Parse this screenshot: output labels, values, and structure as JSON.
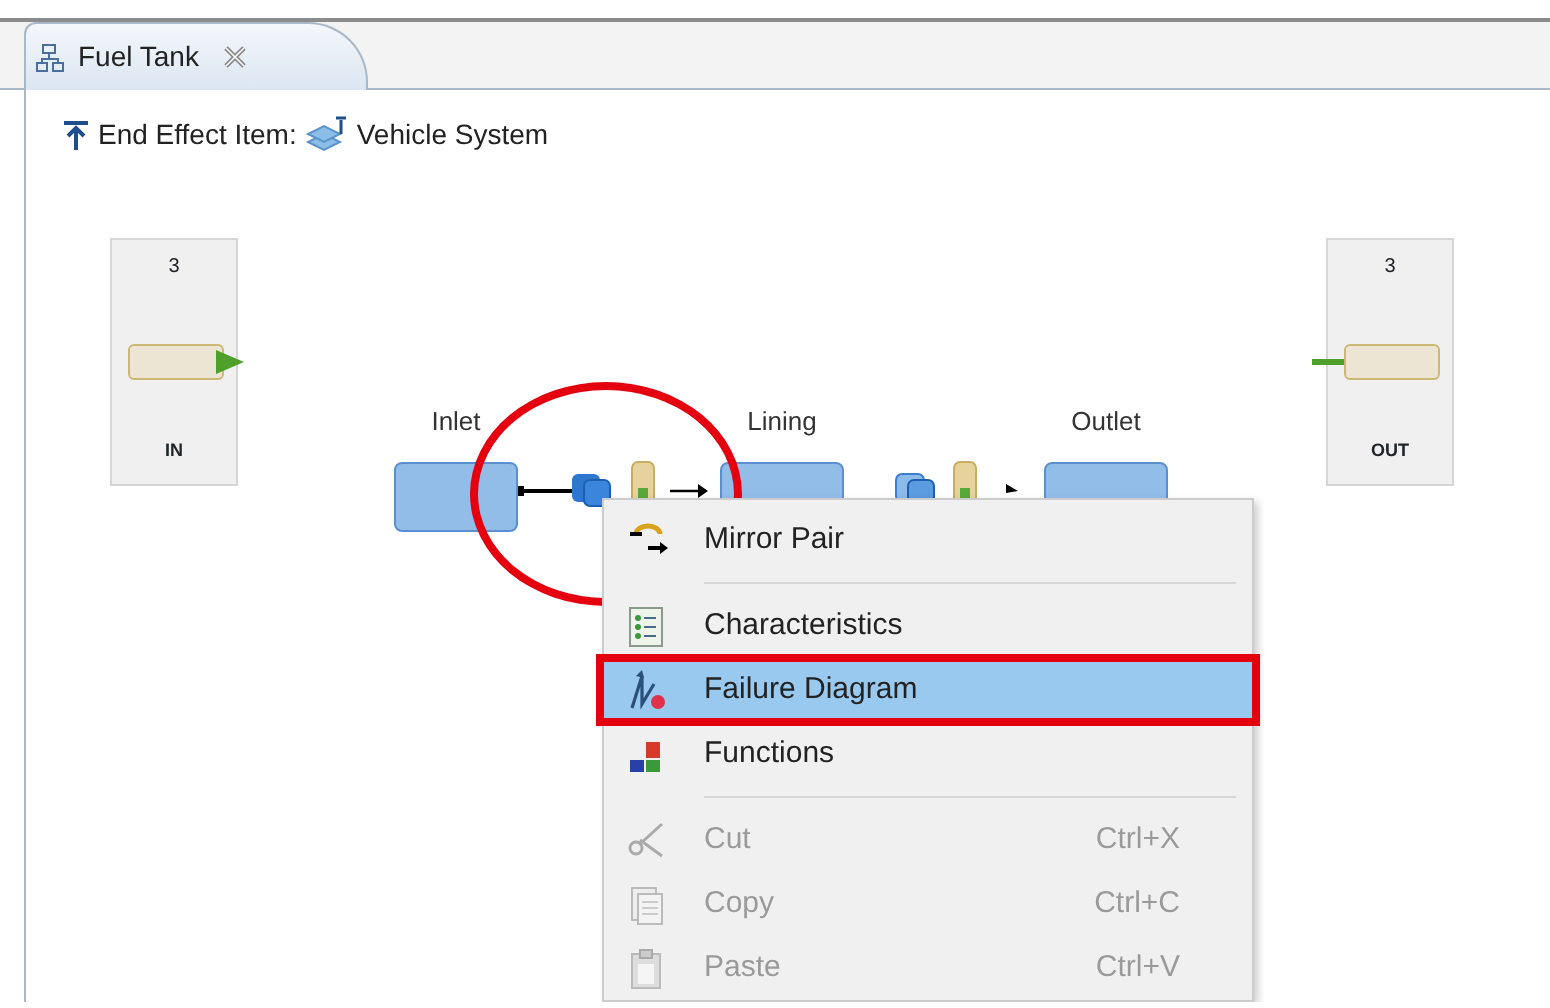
{
  "tab": {
    "title": "Fuel Tank",
    "selected": true
  },
  "end_effect": {
    "label": "End Effect Item:",
    "value": "Vehicle System"
  },
  "ports": [
    {
      "number": "3",
      "label": "IN",
      "kind": "in"
    },
    {
      "number": "3",
      "label": "OUT",
      "kind": "out"
    }
  ],
  "blocks": [
    {
      "name": "Inlet"
    },
    {
      "name": "Lining"
    },
    {
      "name": "Outlet"
    }
  ],
  "context_menu": [
    {
      "kind": "item",
      "label": "Mirror Pair",
      "selected": false,
      "disabled": false
    },
    {
      "kind": "separator"
    },
    {
      "kind": "item",
      "label": "Characteristics",
      "selected": false,
      "disabled": false
    },
    {
      "kind": "item",
      "label": "Failure Diagram",
      "selected": true,
      "disabled": false
    },
    {
      "kind": "item",
      "label": "Functions",
      "selected": false,
      "disabled": false
    },
    {
      "kind": "separator"
    },
    {
      "kind": "item",
      "label": "Cut",
      "shortcut": "Ctrl+X",
      "selected": false,
      "disabled": true
    },
    {
      "kind": "item",
      "label": "Copy",
      "shortcut": "Ctrl+C",
      "selected": false,
      "disabled": true
    },
    {
      "kind": "item",
      "label": "Paste",
      "shortcut": "Ctrl+V",
      "selected": false,
      "disabled": true
    }
  ]
}
